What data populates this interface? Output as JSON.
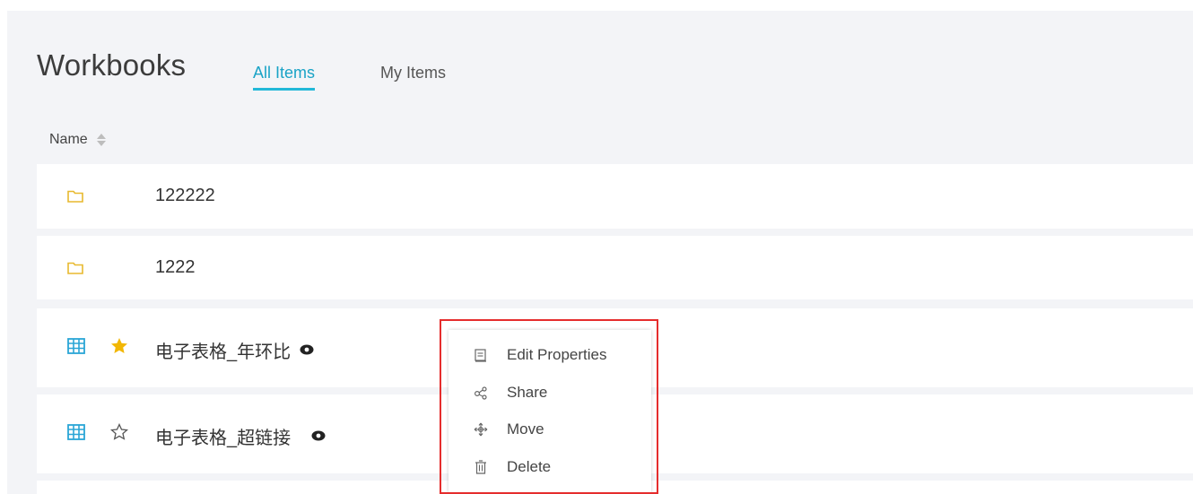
{
  "header": {
    "title": "Workbooks",
    "tabs": [
      {
        "label": "All Items",
        "active": true
      },
      {
        "label": "My Items",
        "active": false
      }
    ]
  },
  "list": {
    "column_name": "Name",
    "rows": [
      {
        "name": "122222",
        "type": "folder"
      },
      {
        "name": "1222",
        "type": "folder"
      },
      {
        "name": "电子表格_年环比",
        "type": "spreadsheet",
        "starred": true,
        "viewable": true
      },
      {
        "name": "电子表格_超链接",
        "type": "spreadsheet",
        "starred": false,
        "viewable": true
      }
    ]
  },
  "context_menu": {
    "items": [
      {
        "label": "Edit Properties",
        "icon": "edit-icon"
      },
      {
        "label": "Share",
        "icon": "share-icon"
      },
      {
        "label": "Move",
        "icon": "move-icon"
      },
      {
        "label": "Delete",
        "icon": "trash-icon"
      }
    ]
  },
  "colors": {
    "accent": "#1aa3c6",
    "folder": "#e8b92f",
    "star": "#f2b705",
    "grid_icon": "#2aa5d6",
    "highlight_frame": "#e52d2d",
    "background": "#f3f4f7"
  }
}
